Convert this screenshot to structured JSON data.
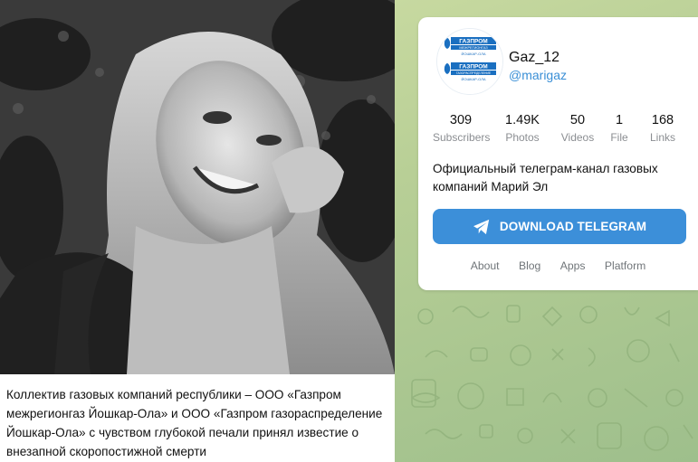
{
  "post": {
    "photo_alt": "black and white portrait photo",
    "text": "Коллектив газовых компаний республики – ООО «Газпром межрегионгаз Йошкар-Ола» и ООО «Газпром газораспределение Йошкар-Ола» с чувством глубокой печали принял известие о внезапной скоропостижной смерти"
  },
  "channel": {
    "logo_line1": "ГАЗПРОМ",
    "logo_line2": "МЕЖРЕГИОНГАЗ",
    "logo_line3": "ЙОШКАР-ОЛА",
    "logo_line4": "ГАЗПРОМ",
    "logo_line5": "ГАЗОРАСПРЕДЕЛЕНИЕ",
    "logo_line6": "ЙОШКАР-ОЛА",
    "name": "Gaz_12",
    "handle": "@marigaz",
    "stats": [
      {
        "value": "309",
        "label": "Subscribers"
      },
      {
        "value": "1.49K",
        "label": "Photos"
      },
      {
        "value": "50",
        "label": "Videos"
      },
      {
        "value": "1",
        "label": "File"
      },
      {
        "value": "168",
        "label": "Links"
      }
    ],
    "description": "Официальный телеграм-канал газовых компаний Марий Эл",
    "download_label": "DOWNLOAD TELEGRAM",
    "footer_links": [
      "About",
      "Blog",
      "Apps",
      "Platform"
    ]
  },
  "colors": {
    "accent": "#3c8fd9",
    "handle": "#3a8fd6",
    "background": "#b9cf9d"
  }
}
